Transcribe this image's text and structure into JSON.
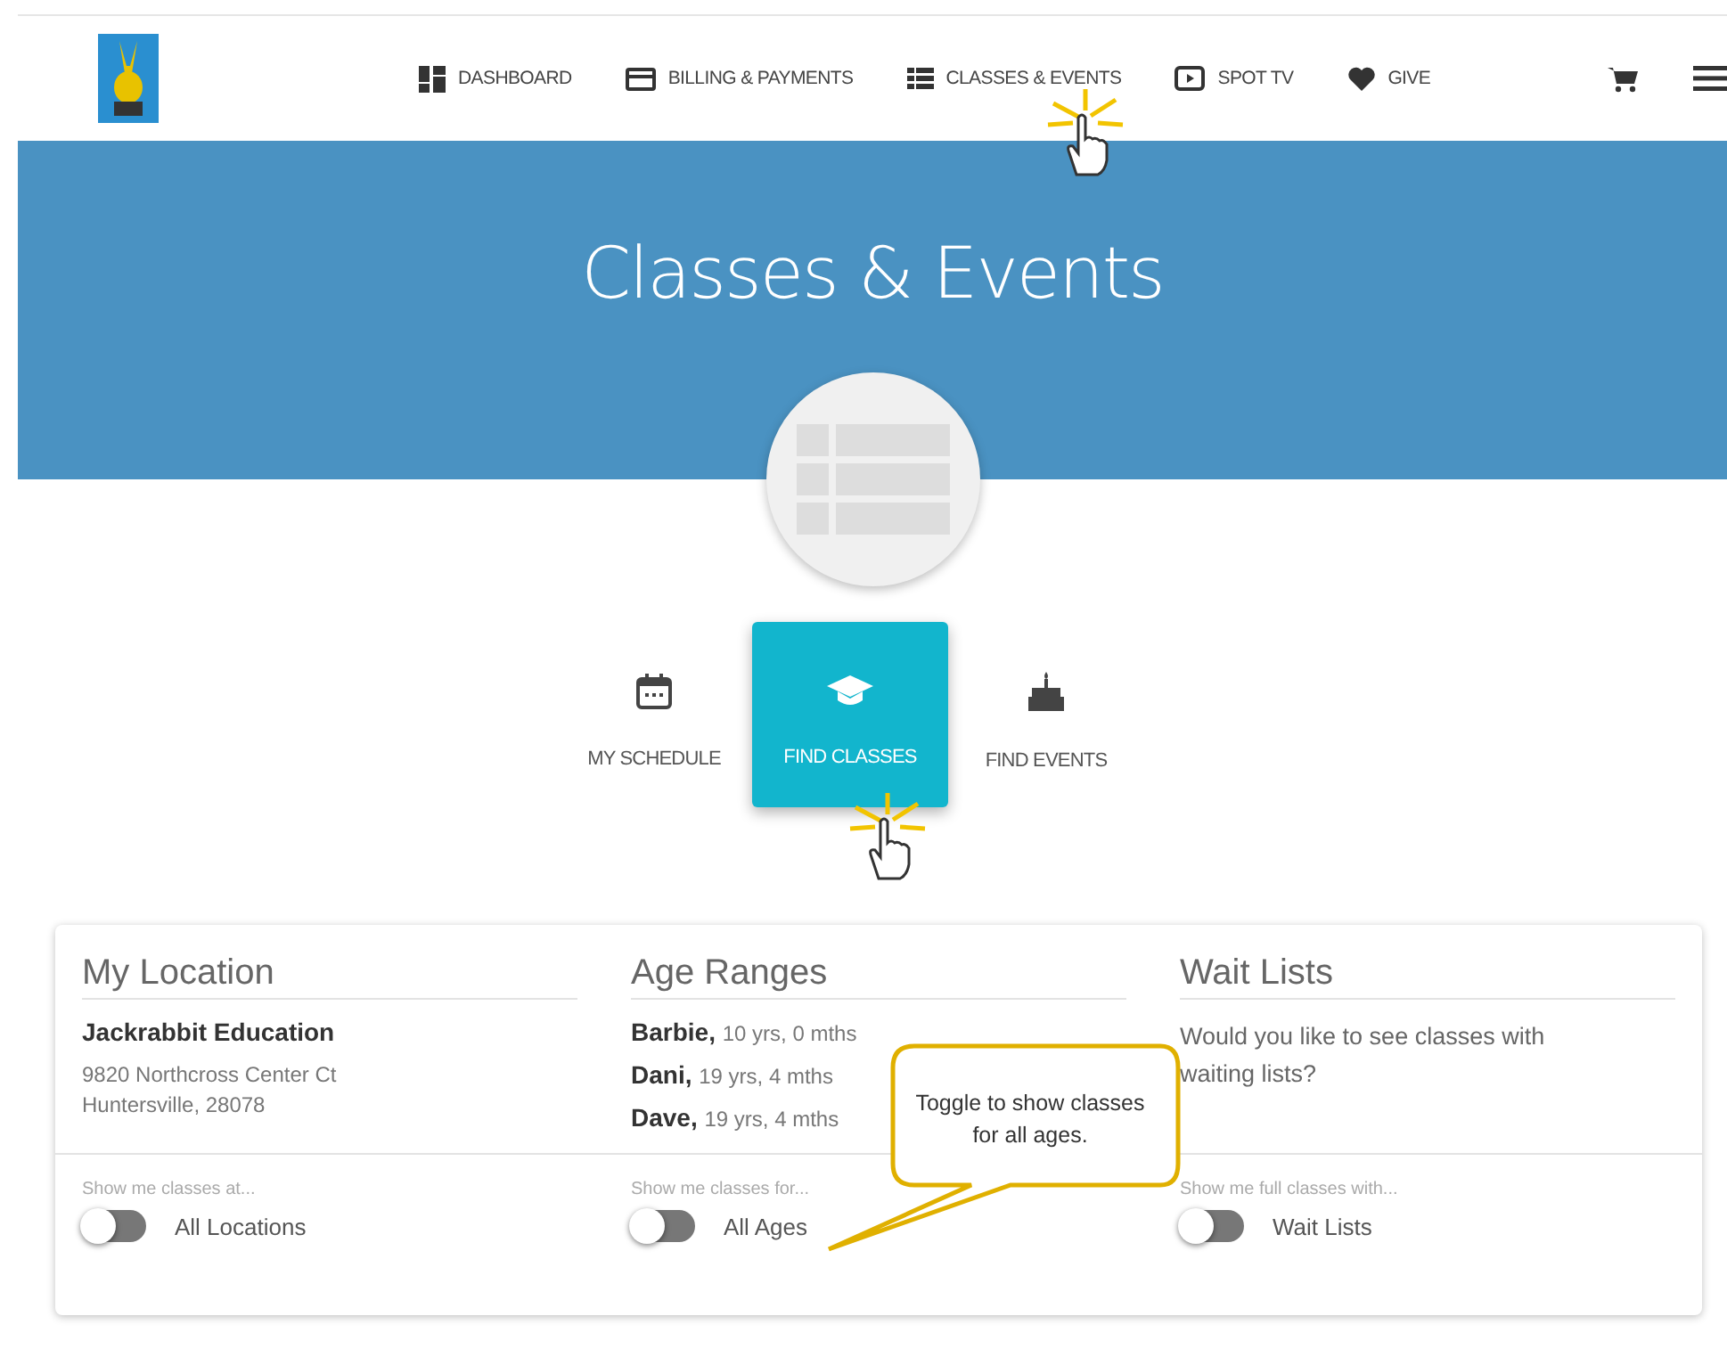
{
  "nav": {
    "items": [
      {
        "kind": "dashboard",
        "label": "DASHBOARD"
      },
      {
        "kind": "billing",
        "label": "BILLING & PAYMENTS"
      },
      {
        "kind": "classes",
        "label": "CLASSES & EVENTS"
      },
      {
        "kind": "tv",
        "label": "SPOT TV"
      },
      {
        "kind": "give",
        "label": "GIVE"
      }
    ]
  },
  "banner": {
    "title": "Classes & Events"
  },
  "tabs": [
    {
      "kind": "schedule",
      "label": "MY SCHEDULE",
      "selected": false
    },
    {
      "kind": "classes",
      "label": "FIND CLASSES",
      "selected": true
    },
    {
      "kind": "events",
      "label": "FIND EVENTS",
      "selected": false
    }
  ],
  "panels": [
    {
      "kind": "address",
      "title": "My Location",
      "name": "Jackrabbit Education",
      "lines": [
        "9820 Northcross Center Ct",
        "Huntersville, 28078"
      ],
      "footer": "Show me classes at...",
      "toggle": {
        "label": "All Locations",
        "on": false
      }
    },
    {
      "kind": "people",
      "title": "Age Ranges",
      "people": [
        {
          "name": "Barbie,",
          "age": "10 yrs, 0 mths"
        },
        {
          "name": "Dani,",
          "age": "19 yrs, 4 mths"
        },
        {
          "name": "Dave,",
          "age": "19 yrs, 4 mths"
        }
      ],
      "footer": "Show me classes for...",
      "toggle": {
        "label": "All Ages",
        "on": false
      }
    },
    {
      "kind": "text",
      "title": "Wait Lists",
      "text": "Would you like to see classes with waiting lists?",
      "footer": "Show me full classes with...",
      "toggle": {
        "label": "Wait Lists",
        "on": false
      }
    }
  ],
  "callout": {
    "text": "Toggle to show classes for all ages."
  }
}
